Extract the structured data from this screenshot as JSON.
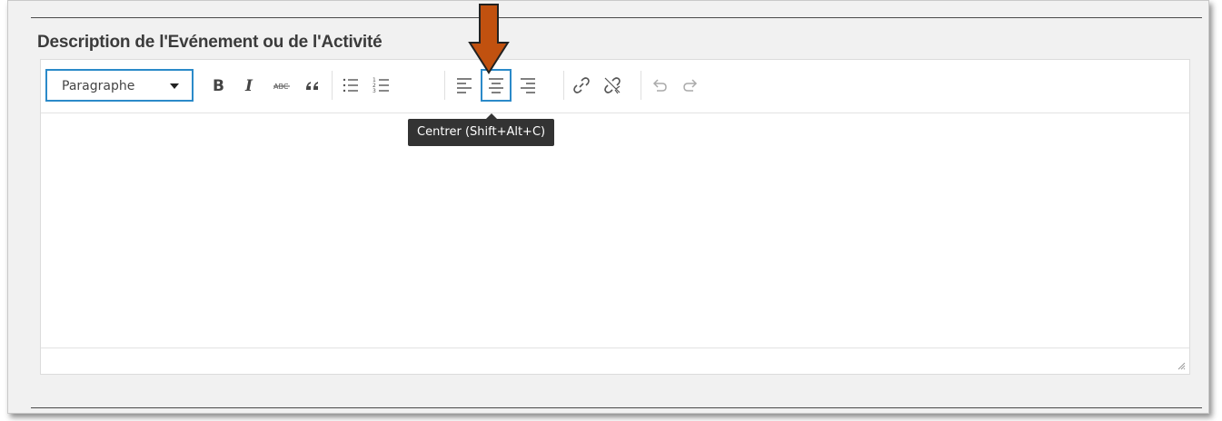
{
  "field": {
    "label": "Description de l'Evénement ou de l'Activité"
  },
  "toolbar": {
    "format_select": {
      "selected": "Paragraphe"
    },
    "buttons": [
      {
        "name": "bold",
        "icon": "bold-icon"
      },
      {
        "name": "italic",
        "icon": "italic-icon"
      },
      {
        "name": "strikethrough",
        "icon": "strikethrough-icon"
      },
      {
        "name": "blockquote",
        "icon": "quote-icon"
      },
      {
        "name": "bullet-list",
        "icon": "bullet-list-icon"
      },
      {
        "name": "numbered-list",
        "icon": "numbered-list-icon"
      },
      {
        "name": "align-left",
        "icon": "align-left-icon"
      },
      {
        "name": "align-center",
        "icon": "align-center-icon",
        "active": true
      },
      {
        "name": "align-right",
        "icon": "align-right-icon"
      },
      {
        "name": "insert-link",
        "icon": "link-icon"
      },
      {
        "name": "remove-link",
        "icon": "unlink-icon"
      },
      {
        "name": "undo",
        "icon": "undo-icon"
      },
      {
        "name": "redo",
        "icon": "redo-icon"
      }
    ]
  },
  "tooltip": {
    "text": "Centrer (Shift+Alt+C)"
  },
  "colors": {
    "accent": "#2b8ac9",
    "arrow": "#c1510f",
    "tooltip_bg": "#333333",
    "panel_bg": "#f1f1f1"
  }
}
